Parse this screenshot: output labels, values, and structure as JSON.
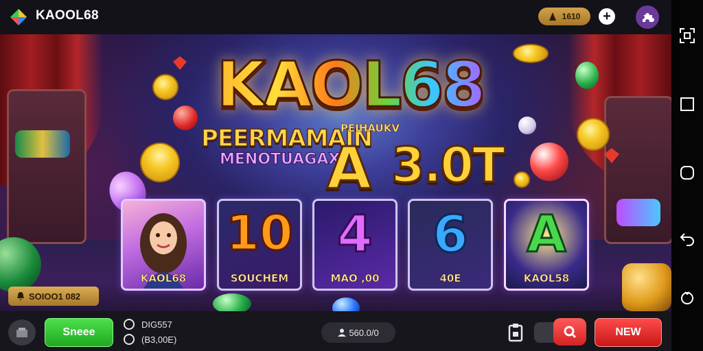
{
  "header": {
    "app_title": "KAOOL68",
    "coin_balance": "1610",
    "add_label": "+",
    "logo_icon": "diamond-logo-icon",
    "puzzle_icon": "puzzle-icon"
  },
  "hero": {
    "title": "KAOL68",
    "subtitle": "PEERMAMAIN",
    "subtitle_small": "PEIHAUKV",
    "tagline": "MENOTUAGAX",
    "big_letter": "A",
    "jackpot": "3.0T"
  },
  "games": [
    {
      "glyph": "",
      "label": "KAOL68",
      "art": "woman-portrait"
    },
    {
      "glyph": "10",
      "label": "SOUCHEM",
      "art": "number-10"
    },
    {
      "glyph": "4",
      "label": "MAO ,00",
      "art": "number-4"
    },
    {
      "glyph": "6",
      "label": "40E",
      "art": "number-6"
    },
    {
      "glyph": "A",
      "label": "KAOL58",
      "art": "letter-a"
    }
  ],
  "balance": {
    "label": "SOIOO1 082",
    "icon": "bell-icon"
  },
  "bottom": {
    "green_label": "Sneee",
    "stat1": "DIG557",
    "stat2": "(B3,00E)",
    "center_value": "560.0/0",
    "red_label": "NEW"
  },
  "colors": {
    "accent_gold": "#f6c623",
    "green_button": "#2fc12f",
    "red_button": "#e02a2a",
    "purple": "#6a3a9a"
  },
  "nav": [
    "qr-scan-icon",
    "square-icon",
    "home-icon",
    "back-icon",
    "assistant-icon"
  ]
}
